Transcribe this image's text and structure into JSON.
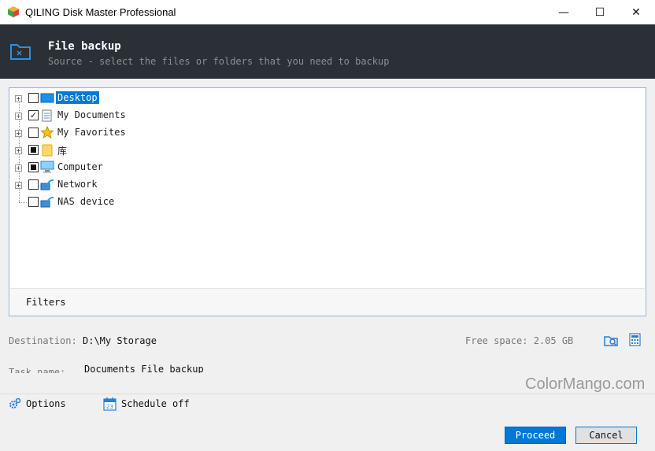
{
  "window": {
    "title": "QILING Disk Master Professional",
    "minimize_glyph": "—",
    "maximize_glyph": "☐",
    "close_glyph": "✕"
  },
  "header": {
    "title": "File backup",
    "subtitle": "Source - select the files or folders that you need to backup"
  },
  "tree": {
    "items": [
      {
        "label": "Desktop",
        "icon": "desktop-icon",
        "state": "unchecked",
        "selected": true
      },
      {
        "label": "My Documents",
        "icon": "documents-icon",
        "state": "checked",
        "selected": false
      },
      {
        "label": "My Favorites",
        "icon": "star-icon",
        "state": "unchecked",
        "selected": false
      },
      {
        "label": "库",
        "icon": "folder-icon",
        "state": "partial",
        "selected": false
      },
      {
        "label": "Computer",
        "icon": "computer-icon",
        "state": "partial",
        "selected": false
      },
      {
        "label": "Network",
        "icon": "network-icon",
        "state": "unchecked",
        "selected": false
      },
      {
        "label": "NAS device",
        "icon": "network-icon",
        "state": "unchecked",
        "selected": false
      }
    ]
  },
  "filters": {
    "label": "Filters"
  },
  "destination": {
    "label": "Destination:",
    "value": "D:\\My Storage",
    "free_space": "Free space: 2.05 GB"
  },
  "task": {
    "label": "Task name:",
    "value": "Documents File backup"
  },
  "watermark": "ColorMango.com",
  "footer": {
    "options_label": "Options",
    "schedule_label": "Schedule off",
    "proceed_label": "Proceed",
    "cancel_label": "Cancel"
  },
  "colors": {
    "header_bg": "#2b2f36",
    "accent": "#0078d7",
    "panel_border": "#8fb3d8"
  }
}
